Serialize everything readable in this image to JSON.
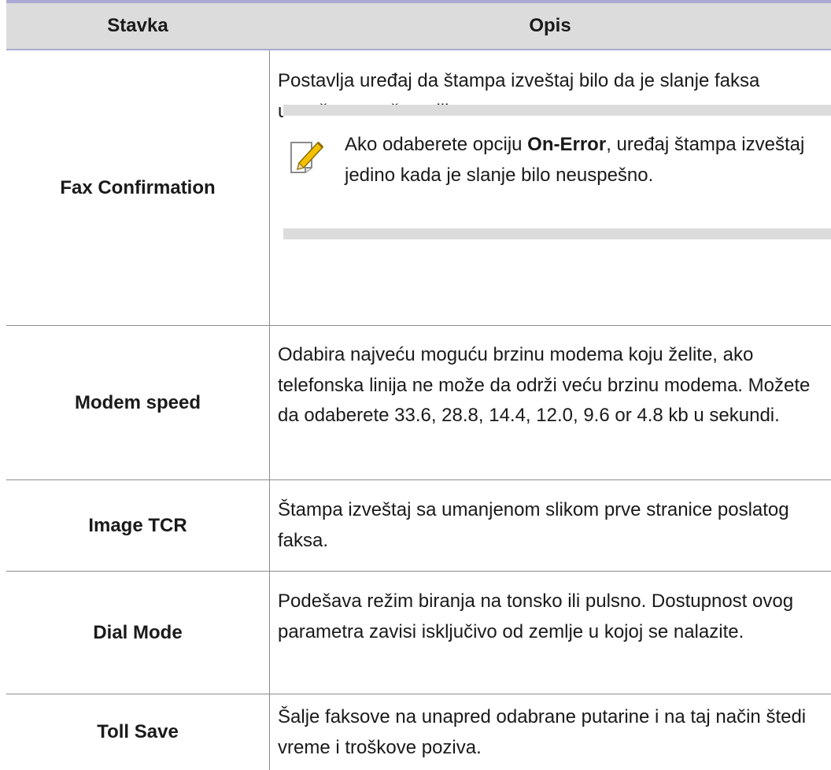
{
  "header": {
    "col_item": "Stavka",
    "col_desc": "Opis"
  },
  "rows": [
    {
      "item": "Fax Confirmation",
      "desc": "Postavlja uređaj da štampa izveštaj bilo da je slanje faksa uspešno završeno ili ne.",
      "note": {
        "icon": "pencil-note-icon",
        "before": "Ako odaberete opciju ",
        "bold": "On-Error",
        "after": ", uređaj štampa izveštaj jedino kada je slanje bilo neuspešno."
      }
    },
    {
      "item": "Modem speed",
      "desc": "Odabira najveću moguću brzinu modema koju želite, ako telefonska linija ne može da održi veću brzinu modema. Možete da odaberete 33.6, 28.8, 14.4, 12.0, 9.6 or 4.8 kb u sekundi."
    },
    {
      "item": "Image TCR",
      "desc": "Štampa izveštaj sa umanjenom slikom prve stranice poslatog faksa."
    },
    {
      "item": "Dial Mode",
      "desc": "Podešava režim biranja na tonsko ili pulsno. Dostupnost ovog parametra zavisi isključivo od zemlje u kojoj se nalazite."
    },
    {
      "item": "Toll Save",
      "desc": "Šalje faksove na unapred odabrane putarine i na taj način štedi vreme i troškove poziva."
    }
  ],
  "colors": {
    "header_bg": "#dcdcdc",
    "rule": "#a9a9d3",
    "grid": "#8c8c8c",
    "note_bar": "#dcdcdc"
  }
}
